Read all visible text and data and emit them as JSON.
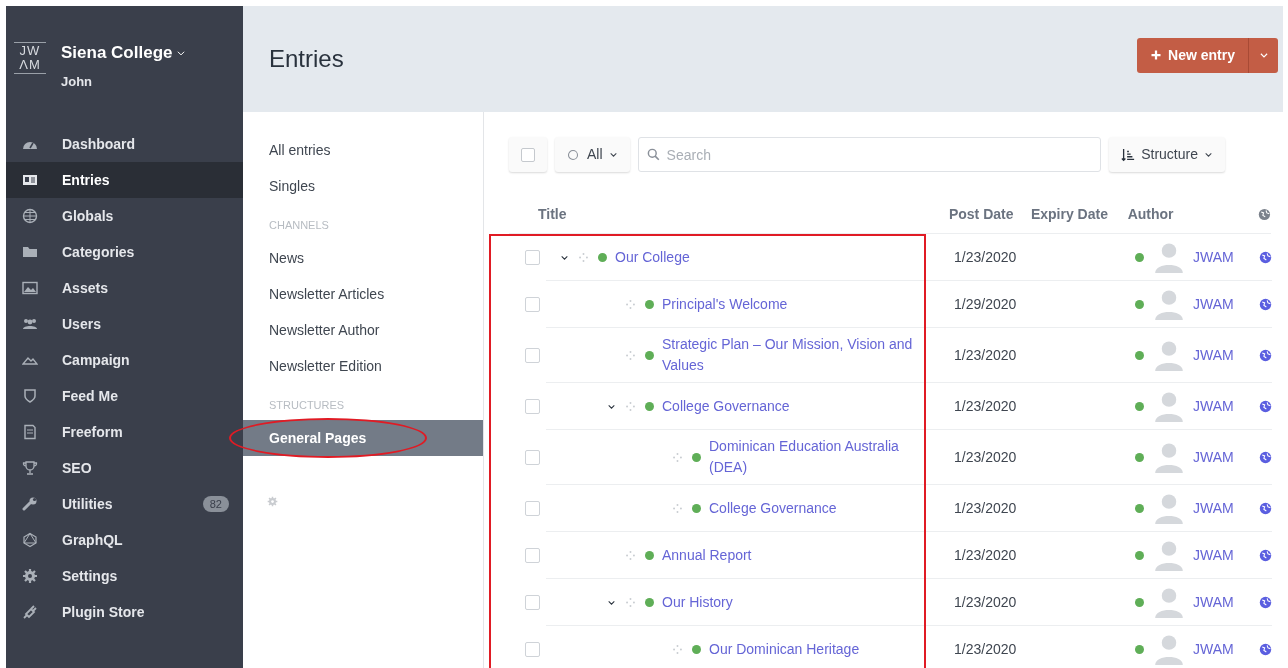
{
  "site": {
    "logo_top": "JW",
    "logo_bottom": "ΛM",
    "name": "Siena College",
    "user": "John"
  },
  "nav": [
    {
      "label": "Dashboard",
      "selected": false
    },
    {
      "label": "Entries",
      "selected": true
    },
    {
      "label": "Globals",
      "selected": false
    },
    {
      "label": "Categories",
      "selected": false
    },
    {
      "label": "Assets",
      "selected": false
    },
    {
      "label": "Users",
      "selected": false
    },
    {
      "label": "Campaign",
      "selected": false
    },
    {
      "label": "Feed Me",
      "selected": false
    },
    {
      "label": "Freeform",
      "selected": false
    },
    {
      "label": "SEO",
      "selected": false
    },
    {
      "label": "Utilities",
      "selected": false,
      "badge": "82"
    },
    {
      "label": "GraphQL",
      "selected": false
    },
    {
      "label": "Settings",
      "selected": false
    },
    {
      "label": "Plugin Store",
      "selected": false
    }
  ],
  "page_title": "Entries",
  "new_button": "New entry",
  "sources": [
    {
      "kind": "item",
      "label": "All entries",
      "selected": false
    },
    {
      "kind": "item",
      "label": "Singles",
      "selected": false
    },
    {
      "kind": "heading",
      "label": "CHANNELS"
    },
    {
      "kind": "item",
      "label": "News",
      "selected": false
    },
    {
      "kind": "item",
      "label": "Newsletter Articles",
      "selected": false
    },
    {
      "kind": "item",
      "label": "Newsletter Author",
      "selected": false
    },
    {
      "kind": "item",
      "label": "Newsletter Edition",
      "selected": false
    },
    {
      "kind": "heading",
      "label": "STRUCTURES"
    },
    {
      "kind": "item",
      "label": "General Pages",
      "selected": true,
      "circled": true
    }
  ],
  "toolbar": {
    "select_all_checked": false,
    "status_filter": "All",
    "search_placeholder": "Search",
    "sort": "Structure"
  },
  "table": {
    "title_column_outlined": true,
    "columns": [
      "Title",
      "Post Date",
      "Expiry Date",
      "Author"
    ],
    "rows": [
      {
        "title": "Our College",
        "post_date": "1/23/2020",
        "author": "JWAM",
        "checked": false,
        "expanded": true,
        "children": [
          {
            "title": "Principal's Welcome",
            "post_date": "1/29/2020",
            "author": "JWAM",
            "checked": false
          },
          {
            "title": "Strategic Plan – Our Mission, Vision and Values",
            "post_date": "1/23/2020",
            "author": "JWAM",
            "checked": false
          },
          {
            "title": "College Governance",
            "post_date": "1/23/2020",
            "author": "JWAM",
            "checked": false,
            "expanded": true,
            "children": [
              {
                "title": "Dominican Education Australia (DEA)",
                "post_date": "1/23/2020",
                "author": "JWAM",
                "checked": false
              },
              {
                "title": "College Governance",
                "post_date": "1/23/2020",
                "author": "JWAM",
                "checked": false
              }
            ]
          },
          {
            "title": "Annual Report",
            "post_date": "1/23/2020",
            "author": "JWAM",
            "checked": false
          },
          {
            "title": "Our History",
            "post_date": "1/23/2020",
            "author": "JWAM",
            "checked": false,
            "expanded": true,
            "children": [
              {
                "title": "Our Dominican Heritage",
                "post_date": "1/23/2020",
                "author": "JWAM",
                "checked": false
              }
            ]
          }
        ]
      }
    ]
  }
}
